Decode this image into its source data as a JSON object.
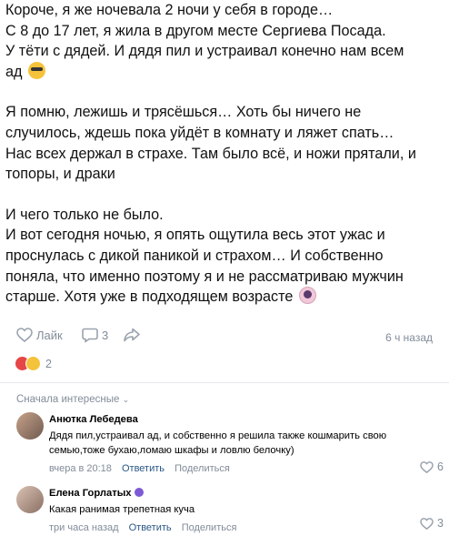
{
  "post": {
    "lines": [
      "Короче, я же ночевала 2 ночи у себя в городе…",
      "С 8 до 17 лет, я жила в другом месте Сергиева Посада.",
      "У тёти с дядей. И дядя пил и устраивал конечно нам всем",
      "ад",
      "Я помню, лежишь и трясёшься… Хоть бы ничего не",
      "случилось, ждешь пока уйдёт в комнату и ляжет спать…",
      "Нас всех держал в страхе. Там было всё, и ножи прятали, и",
      "топоры, и драки",
      "И чего только не было.",
      "И вот сегодня ночью, я опять ощутила весь этот ужас и",
      "проснулась с дикой паникой и страхом… И собственно",
      "поняла, что именно поэтому я и не рассматриваю мужчин",
      "старше. Хотя уже в подходящем возрасте"
    ],
    "emoji_after_line_4": "face-with-sunglasses-icon",
    "emoji_after_line_13": "woman-shrugging-icon"
  },
  "actions": {
    "like_label": "Лайк",
    "comments_count": "3",
    "time_ago": "6 ч назад"
  },
  "reactions": {
    "count": "2",
    "types": [
      "heart",
      "wow"
    ]
  },
  "comments_sort": "Сначала интересные",
  "comments": [
    {
      "name": "Анютка Лебедева",
      "text_line1": "Дядя пил,устраивал ад, и собственно я решила также кошмарить свою",
      "text_line2": "семью,тоже бухаю,ломаю шкафы и ловлю белочку)",
      "time": "вчера в 20:18",
      "reply": "Ответить",
      "share": "Поделиться",
      "likes": "6"
    },
    {
      "name": "Елена Горлатых",
      "text_line1": "Какая ранимая трепетная куча",
      "time": "три часа назад",
      "reply": "Ответить",
      "share": "Поделиться",
      "likes": "3"
    }
  ],
  "colors": {
    "meta_gray": "#818c99",
    "link_blue": "#2a5885",
    "heart_red": "#e64646",
    "divider": "#e7e8ec"
  }
}
